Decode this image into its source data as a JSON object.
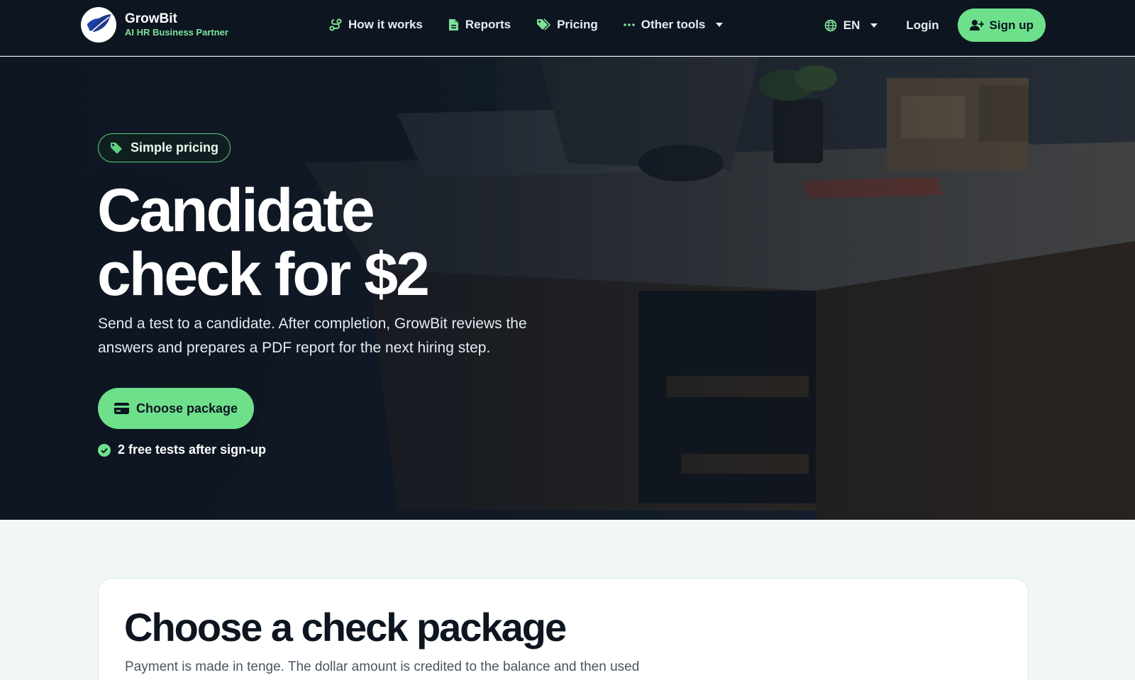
{
  "brand": {
    "name": "GrowBit",
    "tagline": "AI HR Business Partner",
    "logo_icon": "leaf-logo-icon"
  },
  "nav": {
    "links": [
      {
        "label": "How it works",
        "icon": "route-icon"
      },
      {
        "label": "Reports",
        "icon": "document-icon"
      },
      {
        "label": "Pricing",
        "icon": "tags-icon"
      },
      {
        "label": "Other tools",
        "icon": "ellipsis-icon",
        "has_dropdown": true
      }
    ],
    "language": "EN",
    "login_label": "Login",
    "signup_label": "Sign up"
  },
  "hero": {
    "badge": "Simple pricing",
    "title": "Candidate\ncheck for $2",
    "description": "Send a test to a candidate. After completion, GrowBit reviews the answers and prepares a PDF report for the next hiring step.",
    "cta_label": "Choose package",
    "note": "2 free tests after sign-up"
  },
  "packages": {
    "title": "Choose a check package",
    "description": "Payment is made in tenge. The dollar amount is credited to the balance and then used"
  },
  "colors": {
    "accent": "#6ee08c",
    "nav_bg": "#0d1520",
    "page_bg": "#f1f8f4"
  }
}
